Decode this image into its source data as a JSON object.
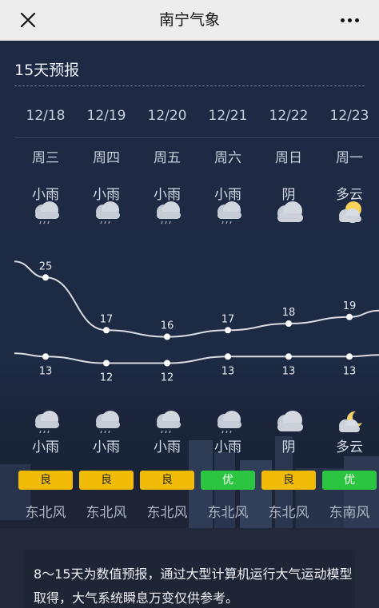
{
  "topbar": {
    "title": "南宁气象"
  },
  "forecast": {
    "section_title": "15天预报",
    "days": [
      {
        "date": "12/18",
        "weekday": "周三",
        "day_condition": "小雨",
        "day_icon": "light-rain-icon",
        "high": "25",
        "low": "13",
        "night_icon": "light-rain-icon",
        "night_condition": "小雨",
        "aqi": "良",
        "wind": "东北风"
      },
      {
        "date": "12/19",
        "weekday": "周四",
        "day_condition": "小雨",
        "day_icon": "light-rain-icon",
        "high": "17",
        "low": "12",
        "night_icon": "light-rain-icon",
        "night_condition": "小雨",
        "aqi": "良",
        "wind": "东北风"
      },
      {
        "date": "12/20",
        "weekday": "周五",
        "day_condition": "小雨",
        "day_icon": "light-rain-icon",
        "high": "16",
        "low": "12",
        "night_icon": "light-rain-icon",
        "night_condition": "小雨",
        "aqi": "良",
        "wind": "东北风"
      },
      {
        "date": "12/21",
        "weekday": "周六",
        "day_condition": "小雨",
        "day_icon": "light-rain-icon",
        "high": "17",
        "low": "13",
        "night_icon": "light-rain-icon",
        "night_condition": "小雨",
        "aqi": "优",
        "wind": "东北风"
      },
      {
        "date": "12/22",
        "weekday": "周日",
        "day_condition": "阴",
        "day_icon": "overcast-icon",
        "high": "18",
        "low": "13",
        "night_icon": "overcast-icon",
        "night_condition": "阴",
        "aqi": "良",
        "wind": "东北风"
      },
      {
        "date": "12/23",
        "weekday": "周一",
        "day_condition": "多云",
        "day_icon": "partly-cloudy-sun-icon",
        "high": "19",
        "low": "13",
        "night_icon": "partly-cloudy-moon-icon",
        "night_condition": "多云",
        "aqi": "优",
        "wind": "东南风"
      }
    ]
  },
  "temperature_chart": {
    "high_values": [
      25,
      17,
      16,
      17,
      18,
      19
    ],
    "low_values": [
      13,
      12,
      12,
      13,
      13,
      13
    ],
    "y_range": [
      10,
      26
    ],
    "line_color": "#d9dce3"
  },
  "aqi_colors": {
    "良": "#f1bb08",
    "优": "#2bc541"
  },
  "note": {
    "text": "8～15天为数值预报，通过大型计算机运行大气运动模型取得，大气系统瞬息万变仅供参考。"
  }
}
